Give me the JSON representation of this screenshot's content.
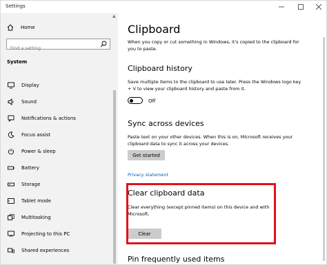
{
  "window": {
    "title": "Settings"
  },
  "sidebar": {
    "home_label": "Home",
    "search_placeholder": "Find a setting",
    "section_label": "System",
    "items": [
      {
        "label": "Display",
        "icon": "display-icon"
      },
      {
        "label": "Sound",
        "icon": "sound-icon"
      },
      {
        "label": "Notifications & actions",
        "icon": "notifications-icon"
      },
      {
        "label": "Focus assist",
        "icon": "focus-assist-icon"
      },
      {
        "label": "Power & sleep",
        "icon": "power-icon"
      },
      {
        "label": "Battery",
        "icon": "battery-icon"
      },
      {
        "label": "Storage",
        "icon": "storage-icon"
      },
      {
        "label": "Tablet mode",
        "icon": "tablet-icon"
      },
      {
        "label": "Multitasking",
        "icon": "multitasking-icon"
      },
      {
        "label": "Projecting to this PC",
        "icon": "projecting-icon"
      },
      {
        "label": "Shared experiences",
        "icon": "shared-experiences-icon"
      }
    ]
  },
  "main": {
    "title": "Clipboard",
    "intro": "When you copy or cut something in Windows, it's copied to the clipboard for you to paste.",
    "history": {
      "heading": "Clipboard history",
      "description": "Save multiple items to the clipboard to use later. Press the Windows logo key + V to view your clipboard history and paste from it.",
      "toggle_label": "Off",
      "toggle_on": false
    },
    "sync": {
      "heading": "Sync across devices",
      "description": "Paste text on your other devices. When this is on, Microsoft receives your clipboard data to sync it across your devices.",
      "button_label": "Get started"
    },
    "privacy_link": "Privacy statement",
    "clear": {
      "heading": "Clear clipboard data",
      "description": "Clear everything (except pinned items) on this device and with Microsoft.",
      "button_label": "Clear"
    },
    "pin_heading": "Pin frequently used items"
  },
  "colors": {
    "accent": "#0060b8",
    "highlight": "#e0101d",
    "sidebar_bg": "#f2f2f2",
    "button_bg": "#cccccc"
  }
}
